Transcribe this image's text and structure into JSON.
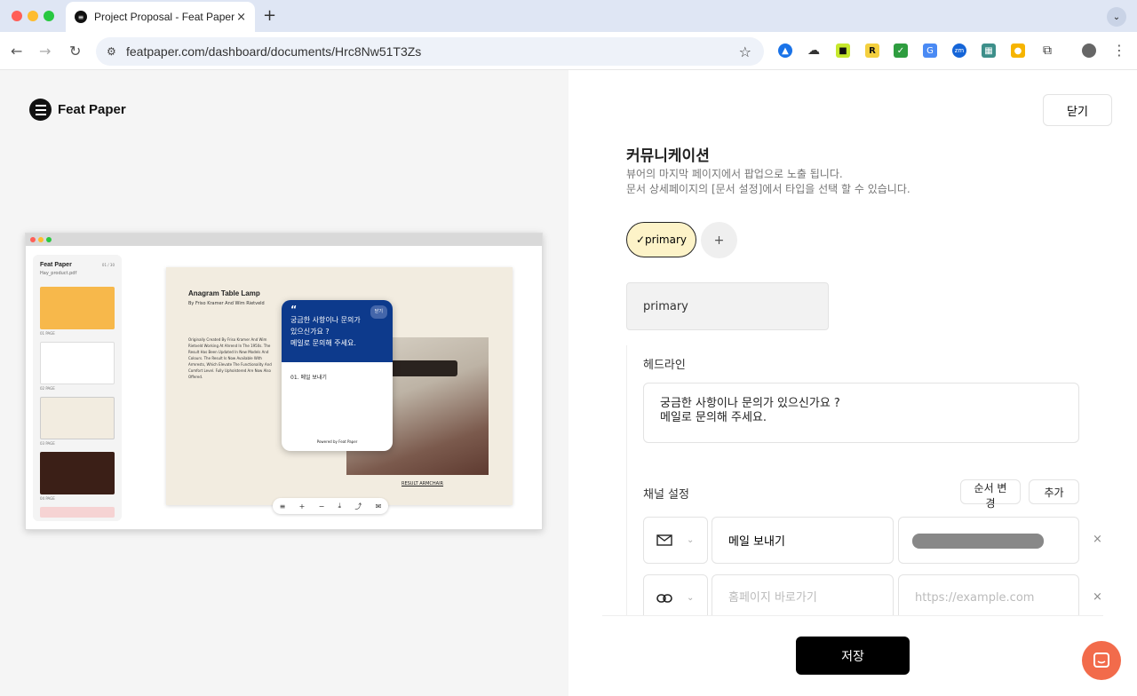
{
  "browser": {
    "tab_title": "Project Proposal - Feat Paper",
    "tab_close": "×",
    "new_tab": "+",
    "url": "featpaper.com/dashboard/documents/Hrc8Nw51T3Zs"
  },
  "brand": {
    "name": "Feat Paper"
  },
  "preview": {
    "sidebar_title": "Feat Paper",
    "sidebar_file": "Hay_product.pdf",
    "sidebar_pages": "01 / 30",
    "thumbs": [
      "01 PAGE",
      "02 PAGE",
      "03 PAGE",
      "04 PAGE"
    ],
    "doc_title": "Anagram Table Lamp",
    "doc_sub": "By Friso Kramer And Wim Rietveld",
    "doc_body": "Originally Created By Friso Kramer And Wim Rietveld Working At Ahrend In The 1950s. The Result Has Been Updated In New Models And Colours. The Result Is Now Available With Armrests, Which Elevate The Functionality And Comfort Level. Fully Upholstered Are Now Also Offered.",
    "caption": "RESULT ARMCHAIR",
    "popup_close": "닫기",
    "popup_text_1": "궁금한 사항이나 문의가",
    "popup_text_2": "있으신가요 ?",
    "popup_text_3": "메일로 문의해 주세요.",
    "popup_item": "01. 메일 보내기",
    "popup_footer": "Powered by Feat Paper"
  },
  "panel": {
    "close_label": "닫기",
    "title": "커뮤니케이션",
    "desc_1": "뷰어의 마지막 페이지에서 팝업으로 노출 됩니다.",
    "desc_2": "문서 상세페이지의  [문서 설정]에서 타입을 선택 할 수 있습니다.",
    "chip_label": "✓primary",
    "add_label": "+",
    "name_value": "primary",
    "headline_label": "헤드라인",
    "headline_line1": "궁금한 사항이나 문의가 있으신가요 ?",
    "headline_line2": "메일로 문의해 주세요.",
    "channel_label": "채널 설정",
    "reorder_label": "순서 변경",
    "add_channel_label": "추가",
    "channels": [
      {
        "icon": "mail-icon",
        "name_value": "메일 보내기",
        "name_placeholder": "",
        "target_value": "",
        "target_placeholder": ""
      },
      {
        "icon": "link-icon",
        "name_value": "",
        "name_placeholder": "홈페이지 바로가기",
        "target_value": "",
        "target_placeholder": "https://example.com"
      }
    ],
    "remove": "×",
    "save_label": "저장"
  }
}
